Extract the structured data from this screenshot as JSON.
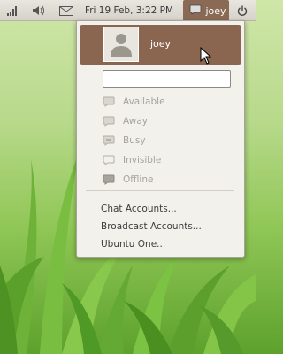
{
  "panel": {
    "clock": "Fri 19 Feb,  3:22 PM",
    "user_label": "joey"
  },
  "menu": {
    "user_name": "joey",
    "status_placeholder": "",
    "statuses": [
      {
        "label": "Available",
        "icon": "chat-bubble-icon"
      },
      {
        "label": "Away",
        "icon": "chat-bubble-icon"
      },
      {
        "label": "Busy",
        "icon": "chat-bubble-icon"
      },
      {
        "label": "Invisible",
        "icon": "chat-bubble-icon"
      },
      {
        "label": "Offline",
        "icon": "chat-bubble-icon"
      }
    ],
    "links": [
      "Chat Accounts...",
      "Broadcast Accounts...",
      "Ubuntu One..."
    ]
  },
  "colors": {
    "panel_bg": "#e1ded6",
    "accent": "#8a6650",
    "menu_bg": "#f2f1ec"
  }
}
